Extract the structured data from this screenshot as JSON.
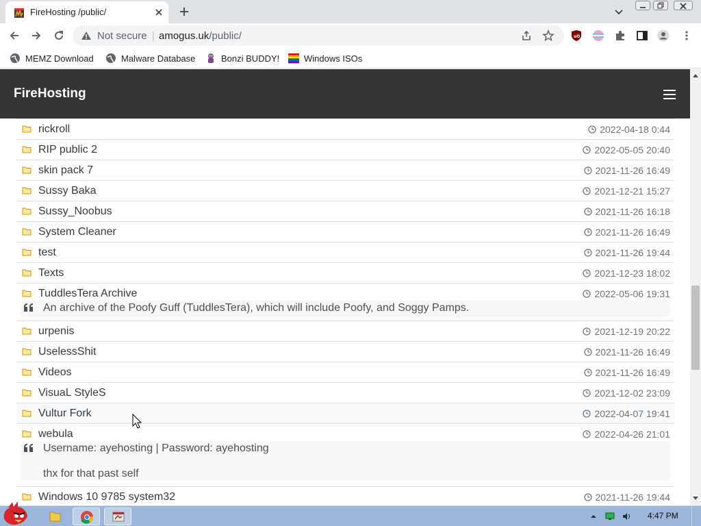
{
  "browser": {
    "tab": {
      "title": "FireHosting /public/",
      "favicon": "firehosting-favicon"
    },
    "omnibox": {
      "security": "Not secure",
      "url_host": "amogus.uk",
      "url_path": "/public/"
    },
    "bookmarks": [
      {
        "label": "MEMZ Download",
        "icon": "globe-icon"
      },
      {
        "label": "Malware Database",
        "icon": "globe-icon"
      },
      {
        "label": "Bonzi BUDDY!",
        "icon": "bonzi-icon"
      },
      {
        "label": "Windows ISOs",
        "icon": "rainbow-flag-icon"
      }
    ]
  },
  "site": {
    "brand": "FireHosting"
  },
  "directory": [
    {
      "name": "rickroll",
      "date": "2022-04-18 0:44"
    },
    {
      "name": "RIP public 2",
      "date": "2022-05-05 20:40"
    },
    {
      "name": "skin pack 7",
      "date": "2021-11-26 16:49"
    },
    {
      "name": "Sussy Baka",
      "date": "2021-12-21 15:27"
    },
    {
      "name": "Sussy_Noobus",
      "date": "2021-11-26 16:18"
    },
    {
      "name": "System Cleaner",
      "date": "2021-11-26 16:49"
    },
    {
      "name": "test",
      "date": "2021-11-26 19:44"
    },
    {
      "name": "Texts",
      "date": "2021-12-23 18:02"
    },
    {
      "name": "TuddlesTera Archive",
      "date": "2022-05-06 19:31",
      "description": [
        "An archive of the Poofy Guff (TuddlesTera), which will include Poofy, and Soggy Pamps."
      ]
    },
    {
      "name": "urpenis",
      "date": "2021-12-19 20:22"
    },
    {
      "name": "UselessShit",
      "date": "2021-11-26 16:49"
    },
    {
      "name": "Videos",
      "date": "2021-11-26 16:49"
    },
    {
      "name": "VisuaL StyleS",
      "date": "2021-12-02 23:09"
    },
    {
      "name": "Vultur Fork",
      "date": "2022-04-07 19:41",
      "hover": true
    },
    {
      "name": "webula",
      "date": "2022-04-26 21:01",
      "description": [
        "Username: ayehosting | Password: ayehosting",
        "thx for that past self"
      ]
    },
    {
      "name": "Windows 10 9785 system32",
      "date": "2021-11-26 19:44"
    }
  ],
  "taskbar": {
    "time": "4:47 PM"
  },
  "colors": {
    "navbar": "#343434",
    "folder": "#f0c33c",
    "taskbar": "#9bb6d8"
  }
}
